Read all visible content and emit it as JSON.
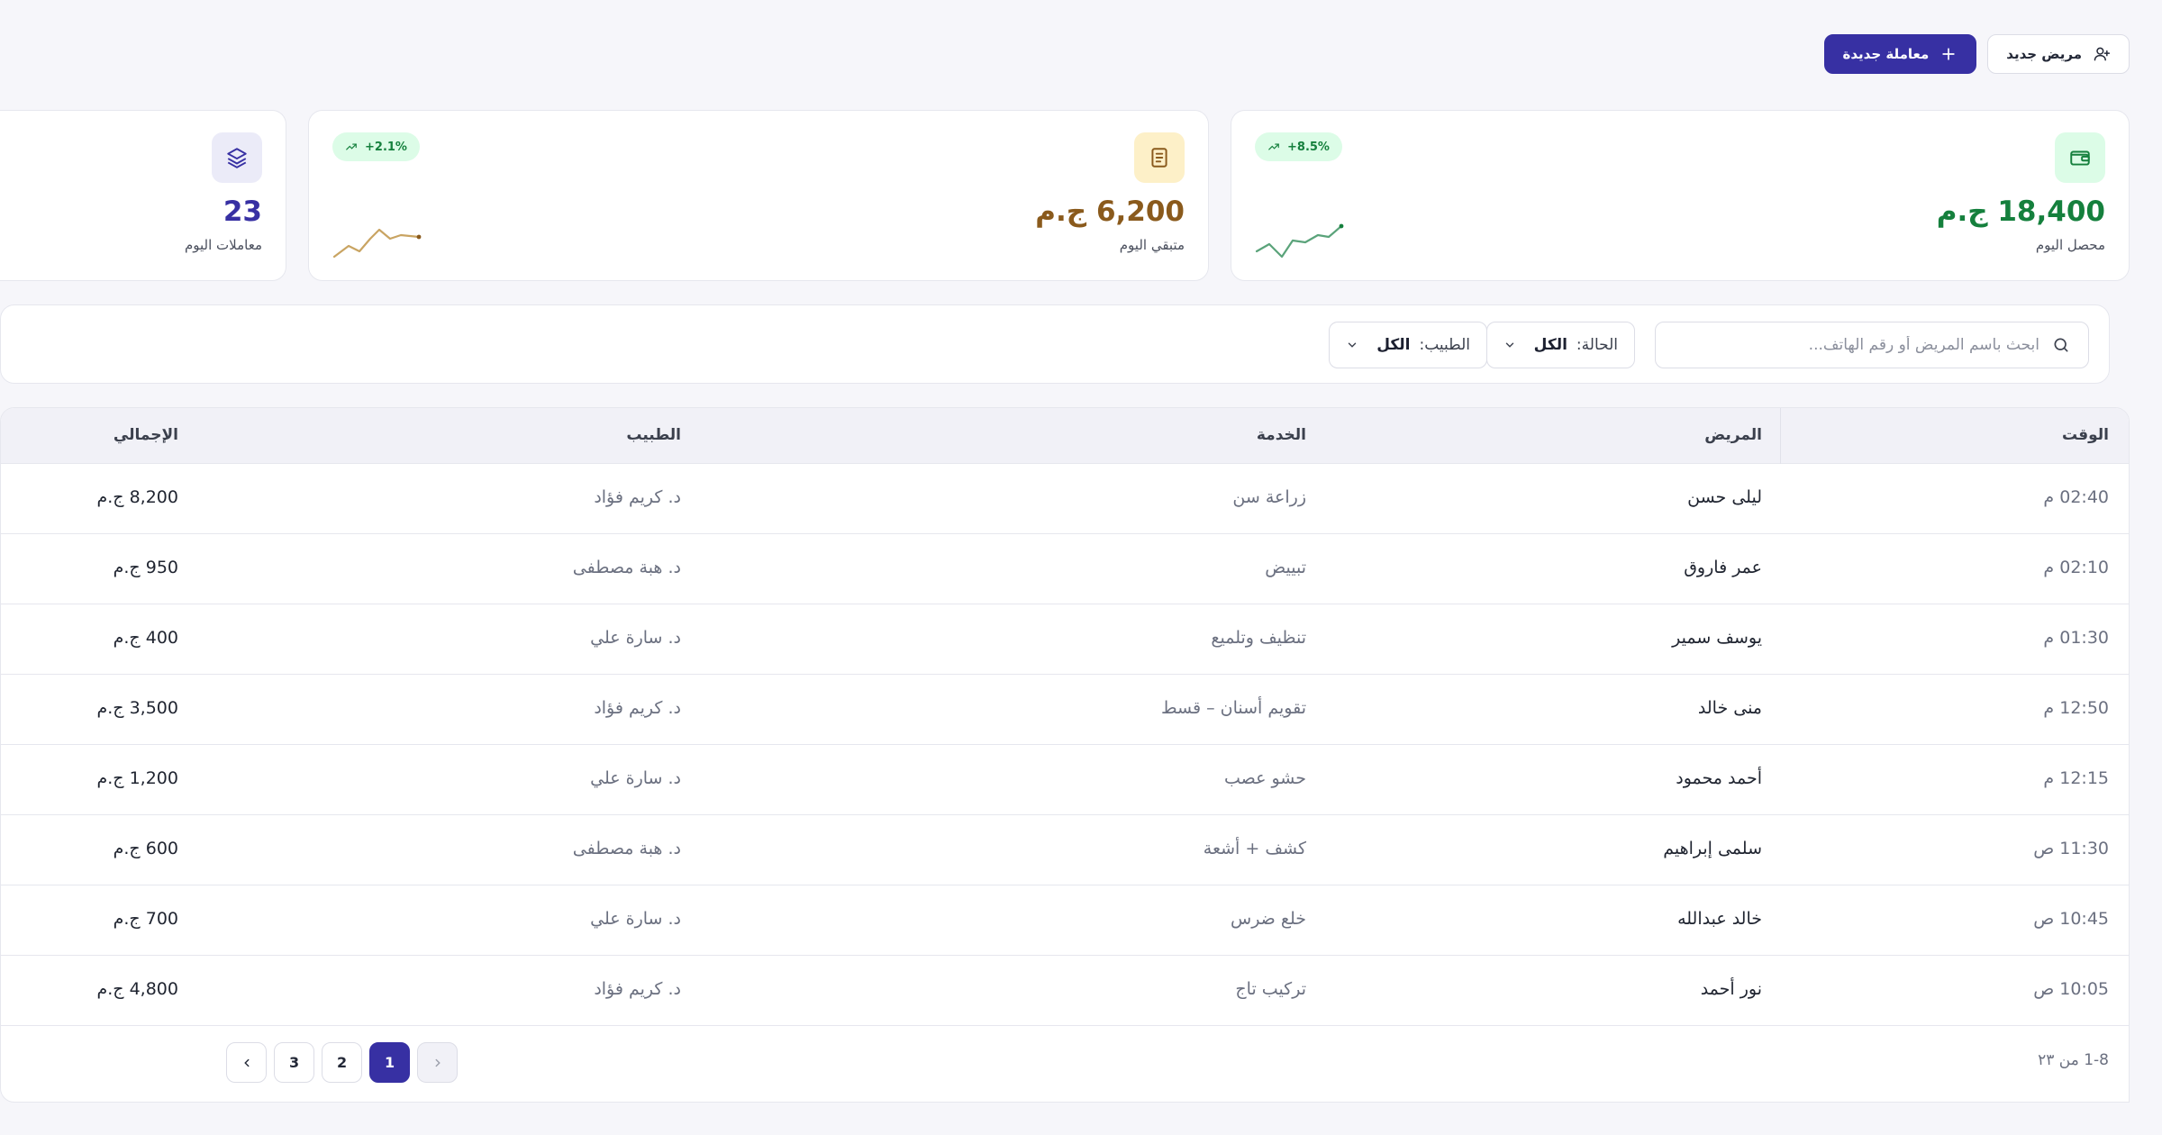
{
  "header": {
    "new_patient_label": "مريض جديد",
    "new_transaction_label": "معاملة جديدة"
  },
  "stats": [
    {
      "value": "18,400 ج.م",
      "label": "محصل اليوم",
      "badge": "+8.5%",
      "icon": "wallet-icon",
      "color": "#15803d",
      "icon_bg": "#dcfce7"
    },
    {
      "value": "6,200 ج.م",
      "label": "متبقي اليوم",
      "badge": "+2.1%",
      "icon": "receipt-icon",
      "color": "#8a5a1c",
      "icon_bg": "#fdf0c8"
    },
    {
      "value": "23",
      "label": "معاملات اليوم",
      "icon": "layers-icon",
      "color": "#3730a3",
      "icon_bg": "#ebebf8"
    }
  ],
  "filters": {
    "search_placeholder": "ابحث باسم المريض أو رقم الهاتف...",
    "status_label": "الحالة:",
    "status_value": "الكل",
    "doctor_label": "الطبيب:",
    "doctor_value": "الكل"
  },
  "table": {
    "columns": [
      "الوقت",
      "المريض",
      "الخدمة",
      "الطبيب",
      "الإجمالي"
    ],
    "rows": [
      {
        "time": "02:40 م",
        "patient": "ليلى حسن",
        "service": "زراعة سن",
        "doctor": "د. كريم فؤاد",
        "total": "8,200 ج.م"
      },
      {
        "time": "02:10 م",
        "patient": "عمر فاروق",
        "service": "تبييض",
        "doctor": "د. هبة مصطفى",
        "total": "950 ج.م"
      },
      {
        "time": "01:30 م",
        "patient": "يوسف سمير",
        "service": "تنظيف وتلميع",
        "doctor": "د. سارة علي",
        "total": "400 ج.م"
      },
      {
        "time": "12:50 م",
        "patient": "منى خالد",
        "service": "تقويم أسنان – قسط",
        "doctor": "د. كريم فؤاد",
        "total": "3,500 ج.م"
      },
      {
        "time": "12:15 م",
        "patient": "أحمد محمود",
        "service": "حشو عصب",
        "doctor": "د. سارة علي",
        "total": "1,200 ج.م"
      },
      {
        "time": "11:30 ص",
        "patient": "سلمى إبراهيم",
        "service": "كشف + أشعة",
        "doctor": "د. هبة مصطفى",
        "total": "600 ج.م"
      },
      {
        "time": "10:45 ص",
        "patient": "خالد عبدالله",
        "service": "خلع ضرس",
        "doctor": "د. سارة علي",
        "total": "700 ج.م"
      },
      {
        "time": "10:05 ص",
        "patient": "نور أحمد",
        "service": "تركيب تاج",
        "doctor": "د. كريم فؤاد",
        "total": "4,800 ج.م"
      }
    ]
  },
  "pagination": {
    "range_text": "1-8 من ٢٣",
    "pages": [
      "1",
      "2",
      "3"
    ],
    "current": "1"
  }
}
